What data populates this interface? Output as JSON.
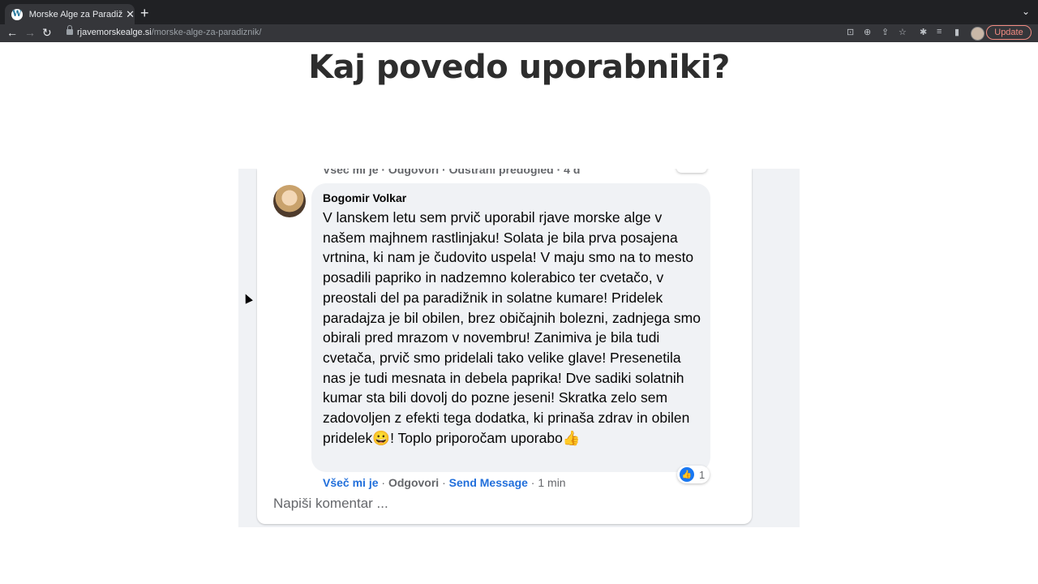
{
  "browser": {
    "tab_title": "Morske Alge za Paradižnik - Rj",
    "url_domain": "rjavemorskealge.si",
    "url_path": "/morske-alge-za-paradiznik/",
    "update_label": "Update"
  },
  "page": {
    "heading": "Kaj povedo uporabniki?"
  },
  "comment": {
    "previous_actions": "Všeč mi je · Odgovori · Odstrani predogled · 4 d",
    "author": "Bogomir Volkar",
    "text": "V lanskem letu sem prvič uporabil rjave morske alge v našem majhnem rastlinjaku! Solata je bila prva posajena vrtnina, ki nam je čudovito uspela! V maju smo na to mesto posadili papriko in nadzemno kolerabico ter cvetačo, v preostali del pa paradižnik in solatne kumare! Pridelek paradajza je bil obilen, brez običajnih bolezni, zadnjega smo obirali pred mrazom v novembru! Zanimiva je bila tudi cvetača, prvič smo pridelali tako velike glave! Presenetila nas je tudi mesnata in debela paprika! Dve sadiki solatnih kumar sta bili dovolj do pozne jeseni! Skratka zelo sem zadovoljen z efekti tega dodatka, ki prinaša zdrav in obilen pridelek😀! Toplo priporočam uporabo👍",
    "like_label": "Všeč mi je",
    "reply_label": "Odgovori",
    "send_message_label": "Send Message",
    "time": "1 min",
    "reaction_count": "1",
    "write_placeholder": "Napiši komentar ..."
  }
}
